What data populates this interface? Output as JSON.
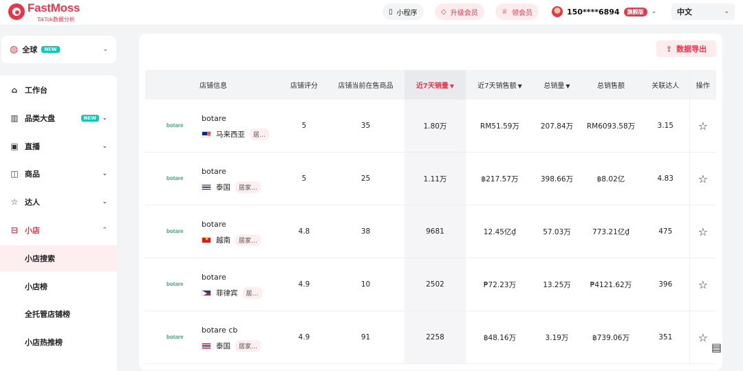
{
  "brand": {
    "name": "FastMoss",
    "tagline": "TikTok数据分析"
  },
  "header": {
    "miniprogram": "小程序",
    "upgrade": "升级会员",
    "get_vip": "领会员",
    "user_phone": "150****6894",
    "vip_badge": "旗舰版",
    "language": "中文"
  },
  "region": {
    "label": "全球",
    "badge": "NEW"
  },
  "sidebar": {
    "items": [
      {
        "label": "工作台",
        "icon": "home-icon"
      },
      {
        "label": "品类大盘",
        "icon": "bar-chart-icon",
        "badge": "NEW"
      },
      {
        "label": "直播",
        "icon": "live-tv-icon"
      },
      {
        "label": "商品",
        "icon": "shopping-bag-icon"
      },
      {
        "label": "达人",
        "icon": "star-person-icon"
      },
      {
        "label": "小店",
        "icon": "shop-icon"
      }
    ],
    "subitems": [
      "小店搜索",
      "小店榜",
      "全托管店铺榜",
      "小店热推榜"
    ]
  },
  "toolbar": {
    "export_label": "数据导出"
  },
  "table": {
    "headers": [
      "店铺信息",
      "店铺评分",
      "店铺当前在售商品",
      "近7天销量",
      "近7天销售额",
      "总销量",
      "总销售额",
      "关联达人",
      "操作"
    ],
    "rows": [
      {
        "logo": "botare",
        "name": "botare",
        "country": "马来西亚",
        "category": "居…",
        "rating": "5",
        "products": "35",
        "sales7": "1.80万",
        "revenue7": "RM51.59万",
        "total_sales": "207.84万",
        "total_revenue": "RM6093.58万",
        "creators": "3.15"
      },
      {
        "logo": "botare",
        "name": "botare",
        "country": "泰国",
        "category": "居家…",
        "rating": "5",
        "products": "25",
        "sales7": "1.11万",
        "revenue7": "฿217.57万",
        "total_sales": "398.66万",
        "total_revenue": "฿8.02亿",
        "creators": "4.83"
      },
      {
        "logo": "botare",
        "name": "botare",
        "country": "越南",
        "category": "居家…",
        "rating": "4.8",
        "products": "38",
        "sales7": "9681",
        "revenue7": "12.45亿₫",
        "total_sales": "57.03万",
        "total_revenue": "773.21亿₫",
        "creators": "475"
      },
      {
        "logo": "botare",
        "name": "botare",
        "country": "菲律宾",
        "category": "居…",
        "rating": "4.9",
        "products": "10",
        "sales7": "2502",
        "revenue7": "₱72.23万",
        "total_sales": "13.25万",
        "total_revenue": "₱4121.62万",
        "creators": "396"
      },
      {
        "logo": "botare",
        "name": "botare cb",
        "country": "泰国",
        "category": "居家…",
        "rating": "4.9",
        "products": "91",
        "sales7": "2258",
        "revenue7": "฿48.16万",
        "total_sales": "3.19万",
        "total_revenue": "฿739.06万",
        "creators": "351"
      }
    ]
  },
  "colors": {
    "accent": "#e8364b",
    "new_badge": "#17c6b5"
  }
}
